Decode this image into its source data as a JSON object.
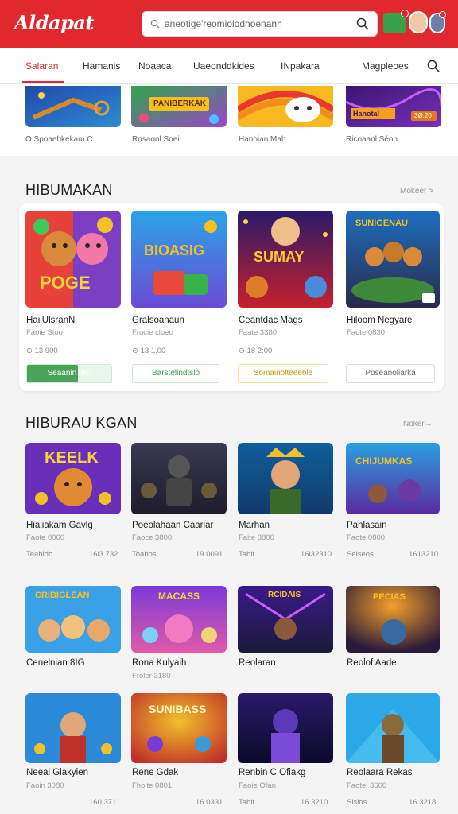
{
  "header": {
    "logo": "Aldapat",
    "search_placeholder": "aneotige'reomiolodhoenanh"
  },
  "nav": {
    "items": [
      "Salaran",
      "Hamanis",
      "Noaaca",
      "Uaeonddkides",
      "INpakara",
      "Magpleoes"
    ],
    "active_index": 0
  },
  "strip": {
    "captions": [
      "O Spoaebkekam C.  . .",
      "Rosaonl Soeil",
      "Hanoian Mah",
      "Ricoaanl Séon"
    ],
    "thumb_texts": [
      "",
      "PANIBERKAK",
      "",
      "Hanotal"
    ],
    "thumb_badges": [
      "",
      "",
      "",
      "3Ø.20"
    ]
  },
  "section1": {
    "title": "HIBUMAKAN",
    "more": "Mokeer  >",
    "games": [
      {
        "art": "POGE",
        "name": "HailUlsranN",
        "sub": "Faoie Stoo",
        "meta": "⊙ 13 900",
        "button": "Seaanin 8IC",
        "fill": 0.6
      },
      {
        "art": "BIOASIG",
        "name": "Gralsoanaun",
        "sub": "Frocie cloeo",
        "meta": "⊙ 13 1.00",
        "button": "Barstelindtslo",
        "fill": 0
      },
      {
        "art": "SUMAY",
        "name": "Ceantdac Mags",
        "sub": "Faate 3380",
        "meta": "⊙ 18 2:00",
        "button": "Somainolteeeble",
        "fill": 0
      },
      {
        "art": "SUNIGENAU",
        "name": "Hiloom Negyare",
        "sub": "Faote 0830",
        "meta": "",
        "button": "Poseanoliarka",
        "fill": 0
      }
    ]
  },
  "section2": {
    "title": "HIBURAU KGAN",
    "more": "Noker→",
    "games": [
      {
        "art": "KEELK",
        "name": "Hialiakam Gavlg",
        "sub": "Faote 0060",
        "meta_l": "Teahido",
        "meta_r": "16i3.732"
      },
      {
        "art": "",
        "name": "Poeolahaan Caariar",
        "sub": "Faoce 3800",
        "meta_l": "Toabos",
        "meta_r": "19.0091"
      },
      {
        "art": "",
        "name": "Marhan",
        "sub": "Faite 3800",
        "meta_l": "Tabit",
        "meta_r": "16i32310"
      },
      {
        "art": "CHIJUMKAS",
        "name": "Panlasain",
        "sub": "Faote 0800",
        "meta_l": "Seiseos",
        "meta_r": "1613210"
      },
      {
        "art": "CRIBIGLEAN",
        "name": "Cenelnian 8IG",
        "sub": "",
        "meta_l": "",
        "meta_r": ""
      },
      {
        "art": "MACASS",
        "name": "Rona Kulyaih",
        "sub": "Froler 3180",
        "meta_l": "",
        "meta_r": ""
      },
      {
        "art": "RCIDAIS",
        "name": "Reolaran",
        "sub": "",
        "meta_l": "",
        "meta_r": ""
      },
      {
        "art": "PECIAS",
        "name": "Reolof Aade",
        "sub": "",
        "meta_l": "",
        "meta_r": ""
      },
      {
        "art": "",
        "name": "Neeai Glakyien",
        "sub": "Faoin 3080",
        "meta_l": "",
        "meta_r": "160.3711"
      },
      {
        "art": "SUNIBASS",
        "name": "Rene Gdak",
        "sub": "Fhoite 0801",
        "meta_l": "",
        "meta_r": "16.0331"
      },
      {
        "art": "",
        "name": "Renbin C Ofiakg",
        "sub": "Faoie Ofan",
        "meta_l": "Tabit",
        "meta_r": "16.3210"
      },
      {
        "art": "",
        "name": "Reolaara Rekas",
        "sub": "Faotei 3600",
        "meta_l": "Sislos",
        "meta_r": "16.3218"
      }
    ]
  },
  "colors": {
    "brand": "#e0282e",
    "green": "#49a35a",
    "yellow": "#c99a10"
  }
}
